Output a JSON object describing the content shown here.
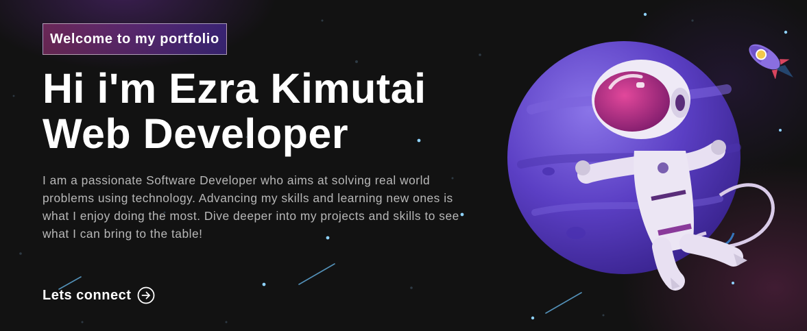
{
  "banner": {
    "tagline": "Welcome to my portfolio",
    "headline_line1": "Hi i'm Ezra Kimutai",
    "headline_line2": "Web Developer",
    "intro": "I am a passionate Software Developer who aims at solving real world problems using technology. Advancing my skills and learning new ones is what I enjoy doing the most. Dive deeper into my projects and skills to see what I can bring to the table!",
    "cta_label": "Lets connect",
    "cta_icon": "arrow-right-circle-icon"
  },
  "illustration": {
    "subject": "astronaut-planet-illustration",
    "rocket": "rocket-icon"
  },
  "colors": {
    "background": "#121212",
    "text": "#ffffff",
    "muted_text": "#b8b8b8",
    "accent_pink": "#AA367C",
    "accent_purple": "#4A2FBD",
    "planet": "#6a4fd0"
  }
}
